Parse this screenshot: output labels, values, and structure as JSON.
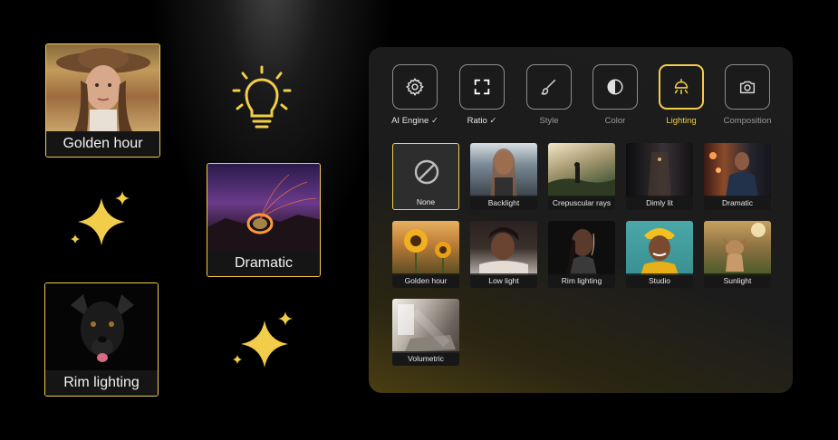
{
  "left_cards": [
    {
      "id": "golden-hour",
      "label": "Golden hour"
    },
    {
      "id": "dramatic",
      "label": "Dramatic"
    },
    {
      "id": "rim-lighting",
      "label": "Rim lighting"
    }
  ],
  "toolbar": [
    {
      "id": "ai-engine",
      "label": "AI Engine",
      "checked": true,
      "icon": "gear-icon"
    },
    {
      "id": "ratio",
      "label": "Ratio",
      "checked": true,
      "icon": "frame-corners-icon"
    },
    {
      "id": "style",
      "label": "Style",
      "checked": false,
      "icon": "brush-icon"
    },
    {
      "id": "color",
      "label": "Color",
      "checked": false,
      "icon": "contrast-icon"
    },
    {
      "id": "lighting",
      "label": "Lighting",
      "checked": false,
      "icon": "lamp-icon",
      "active": true
    },
    {
      "id": "composition",
      "label": "Composition",
      "checked": false,
      "icon": "camera-icon"
    }
  ],
  "check_glyph": "✓",
  "tiles": [
    {
      "label": "None"
    },
    {
      "label": "Backlight"
    },
    {
      "label": "Crepuscular rays"
    },
    {
      "label": "Dimly lit"
    },
    {
      "label": "Dramatic"
    },
    {
      "label": "Golden hour"
    },
    {
      "label": "Low light"
    },
    {
      "label": "Rim lighting"
    },
    {
      "label": "Studio"
    },
    {
      "label": "Sunlight"
    },
    {
      "label": "Volumetric"
    }
  ],
  "colors": {
    "accent": "#f2cd4a",
    "panel": "#1d1d1d"
  }
}
